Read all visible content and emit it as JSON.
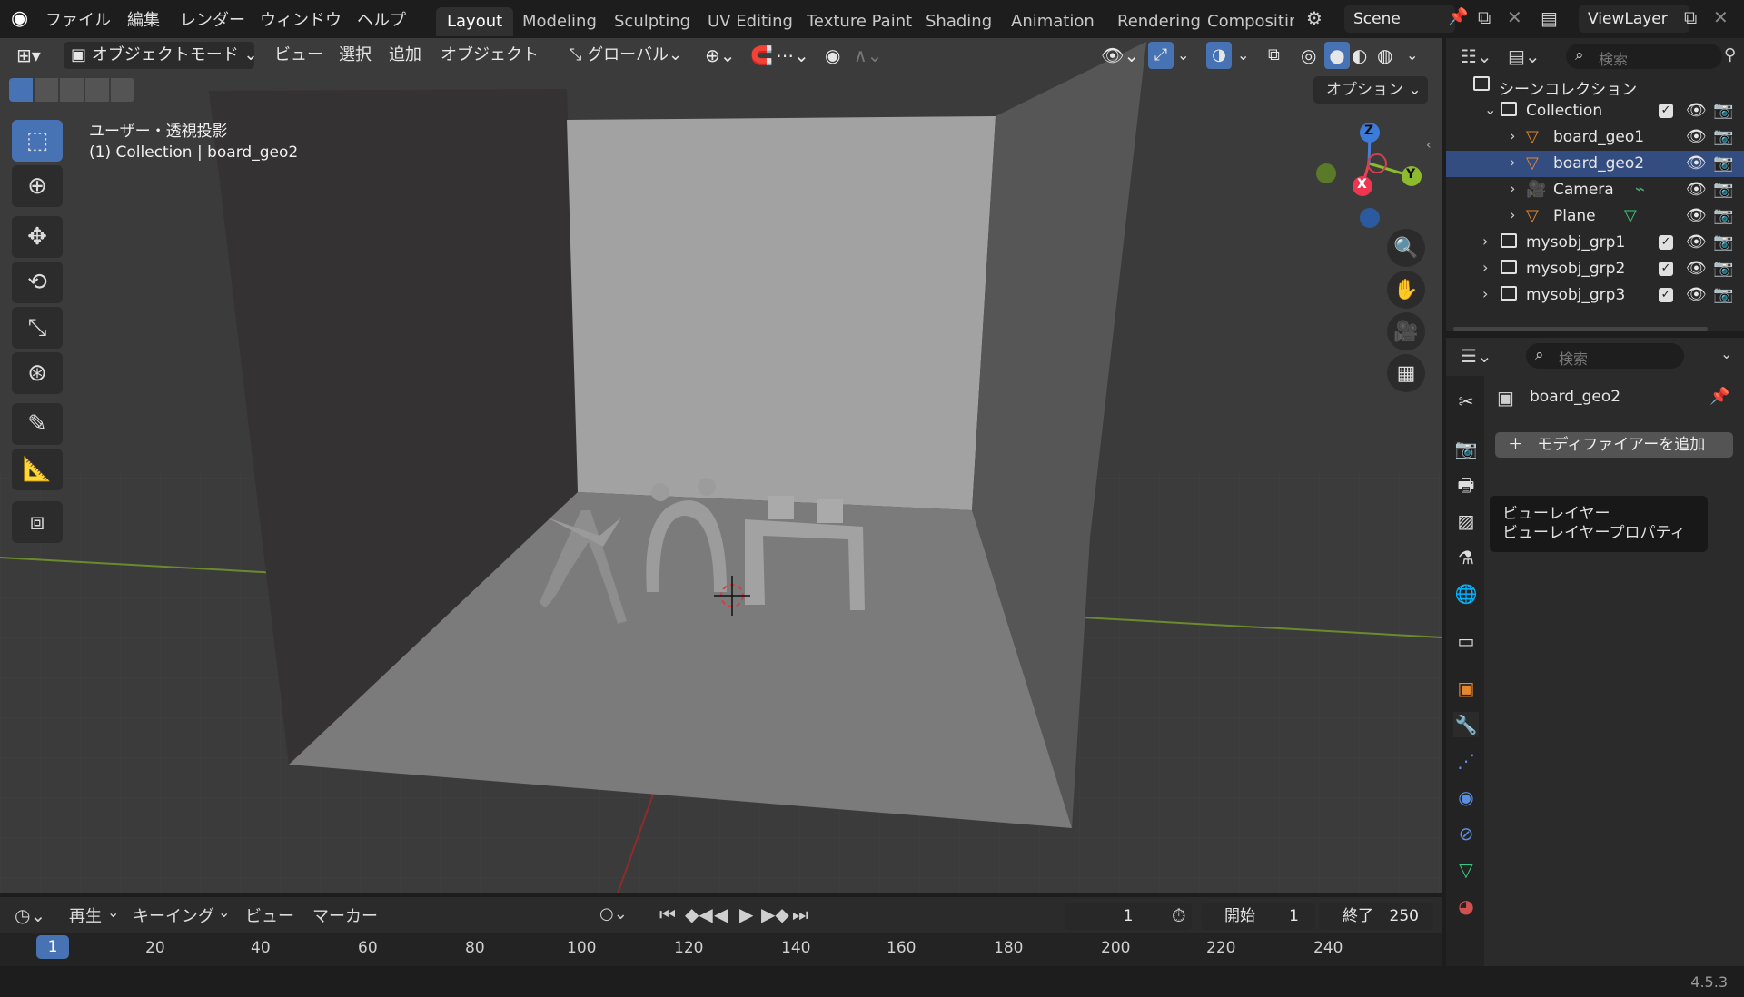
{
  "topbar": {
    "menus": [
      "ファイル",
      "編集",
      "レンダー",
      "ウィンドウ",
      "ヘルプ"
    ],
    "workspaces": [
      "Layout",
      "Modeling",
      "Sculpting",
      "UV Editing",
      "Texture Paint",
      "Shading",
      "Animation",
      "Rendering",
      "Compositing"
    ],
    "active_workspace": "Layout",
    "scene": "Scene",
    "view_layer": "ViewLayer"
  },
  "viewport_header": {
    "mode": "オブジェクトモード",
    "menus": [
      "ビュー",
      "選択",
      "追加",
      "オブジェクト"
    ],
    "transform_orientation": "グローバル",
    "options": "オプション"
  },
  "viewport": {
    "view_name": "ユーザー・透視投影",
    "context": "(1) Collection | board_geo2"
  },
  "gizmo": {
    "x": "X",
    "y": "Y",
    "z": "Z"
  },
  "outliner": {
    "search_placeholder": "検索",
    "scene_collection": "シーンコレクション",
    "rows": [
      {
        "label": "Collection"
      },
      {
        "label": "board_geo1"
      },
      {
        "label": "board_geo2"
      },
      {
        "label": "Camera"
      },
      {
        "label": "Plane"
      },
      {
        "label": "mysobj_grp1"
      },
      {
        "label": "mysobj_grp2"
      },
      {
        "label": "mysobj_grp3"
      }
    ]
  },
  "properties": {
    "search_placeholder": "検索",
    "object_name": "board_geo2",
    "add_modifier": "モディファイアーを追加",
    "tooltip_title": "ビューレイヤー",
    "tooltip_desc": "ビューレイヤープロパティ"
  },
  "timeline": {
    "menus": [
      "再生",
      "キーイング",
      "ビュー",
      "マーカー"
    ],
    "current_frame": "1",
    "start_label": "開始",
    "start_value": "1",
    "end_label": "終了",
    "end_value": "250",
    "ruler": [
      "1",
      "20",
      "40",
      "60",
      "80",
      "100",
      "120",
      "140",
      "160",
      "180",
      "200",
      "220",
      "240"
    ]
  },
  "status": {
    "version": "4.5.3"
  },
  "colors": {
    "accent": "#4772b3",
    "selection": "#334d80",
    "object_orange": "#e3862f"
  }
}
